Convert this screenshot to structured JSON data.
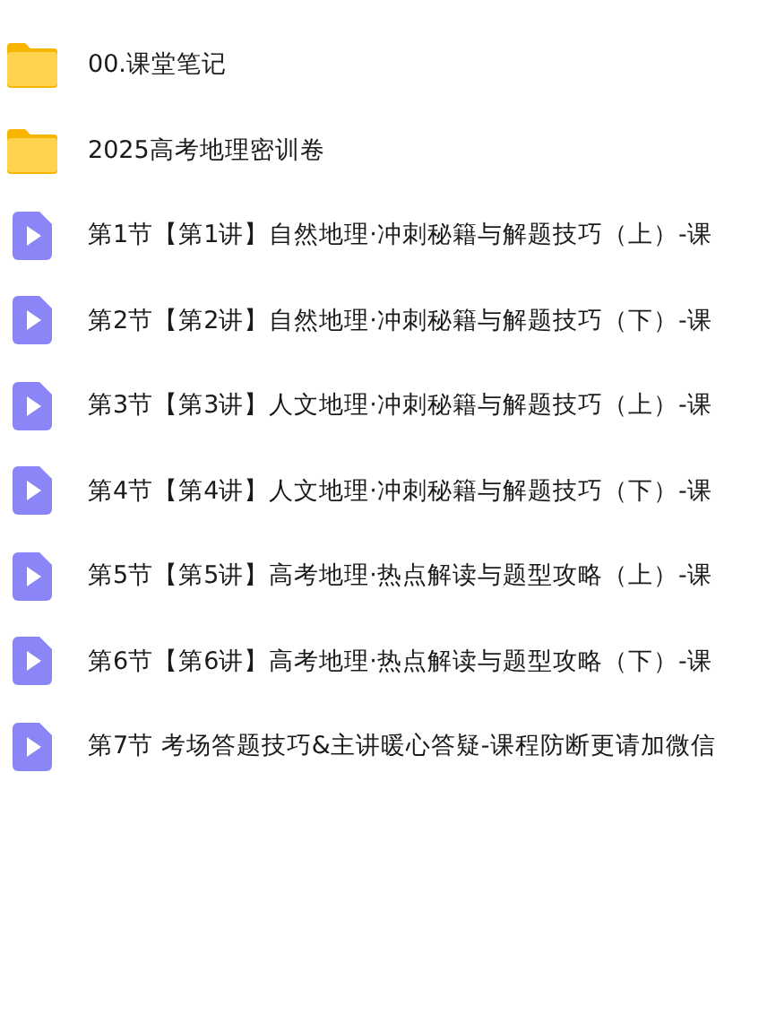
{
  "files": [
    {
      "kind": "folder",
      "name": "00.课堂笔记"
    },
    {
      "kind": "folder",
      "name": "2025高考地理密训卷"
    },
    {
      "kind": "video",
      "name": "第1节【第1讲】自然地理·冲刺秘籍与解题技巧（上）-课"
    },
    {
      "kind": "video",
      "name": "第2节【第2讲】自然地理·冲刺秘籍与解题技巧（下）-课"
    },
    {
      "kind": "video",
      "name": "第3节【第3讲】人文地理·冲刺秘籍与解题技巧（上）-课"
    },
    {
      "kind": "video",
      "name": "第4节【第4讲】人文地理·冲刺秘籍与解题技巧（下）-课"
    },
    {
      "kind": "video",
      "name": "第5节【第5讲】高考地理·热点解读与题型攻略（上）-课"
    },
    {
      "kind": "video",
      "name": "第6节【第6讲】高考地理·热点解读与题型攻略（下）-课"
    },
    {
      "kind": "video",
      "name": "第7节 考场答题技巧&主讲暖心答疑-课程防断更请加微信"
    }
  ]
}
